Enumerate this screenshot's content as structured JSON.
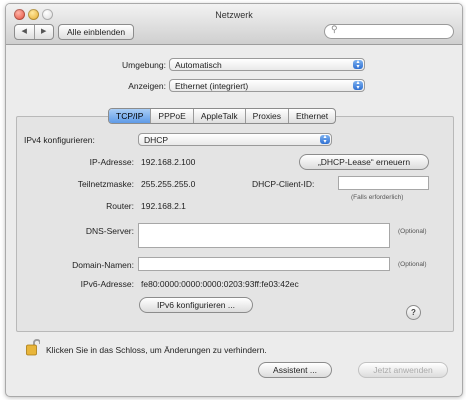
{
  "window": {
    "title": "Netzwerk"
  },
  "toolbar": {
    "back": "◀",
    "forward": "▶",
    "show_all": "Alle einblenden",
    "search_placeholder": ""
  },
  "top": {
    "location_label": "Umgebung:",
    "location_value": "Automatisch",
    "show_label": "Anzeigen:",
    "show_value": "Ethernet (integriert)"
  },
  "tabs": [
    "TCP/IP",
    "PPPoE",
    "AppleTalk",
    "Proxies",
    "Ethernet"
  ],
  "tcpip": {
    "configure_label": "IPv4 konfigurieren:",
    "configure_value": "DHCP",
    "ip_label": "IP-Adresse:",
    "ip_value": "192.168.2.100",
    "renew_button": "„DHCP-Lease“ erneuern",
    "subnet_label": "Teilnetzmaske:",
    "subnet_value": "255.255.255.0",
    "client_id_label": "DHCP-Client-ID:",
    "client_id_value": "",
    "client_id_note": "(Falls erforderlich)",
    "router_label": "Router:",
    "router_value": "192.168.2.1",
    "dns_label": "DNS-Server:",
    "dns_value": "",
    "optional_1": "(Optional)",
    "domain_label": "Domain-Namen:",
    "domain_value": "",
    "optional_2": "(Optional)",
    "ipv6_label": "IPv6-Adresse:",
    "ipv6_value": "fe80:0000:0000:0000:0203:93ff:fe03:42ec",
    "ipv6_button": "IPv6 konfigurieren ...",
    "help": "?"
  },
  "footer": {
    "lock_text": "Klicken Sie in das Schloss, um Änderungen zu verhindern.",
    "assistant_button": "Assistent ...",
    "apply_button": "Jetzt anwenden"
  },
  "colors": {
    "selected_tab": "#5f9be8",
    "window_bg": "#ececec"
  }
}
